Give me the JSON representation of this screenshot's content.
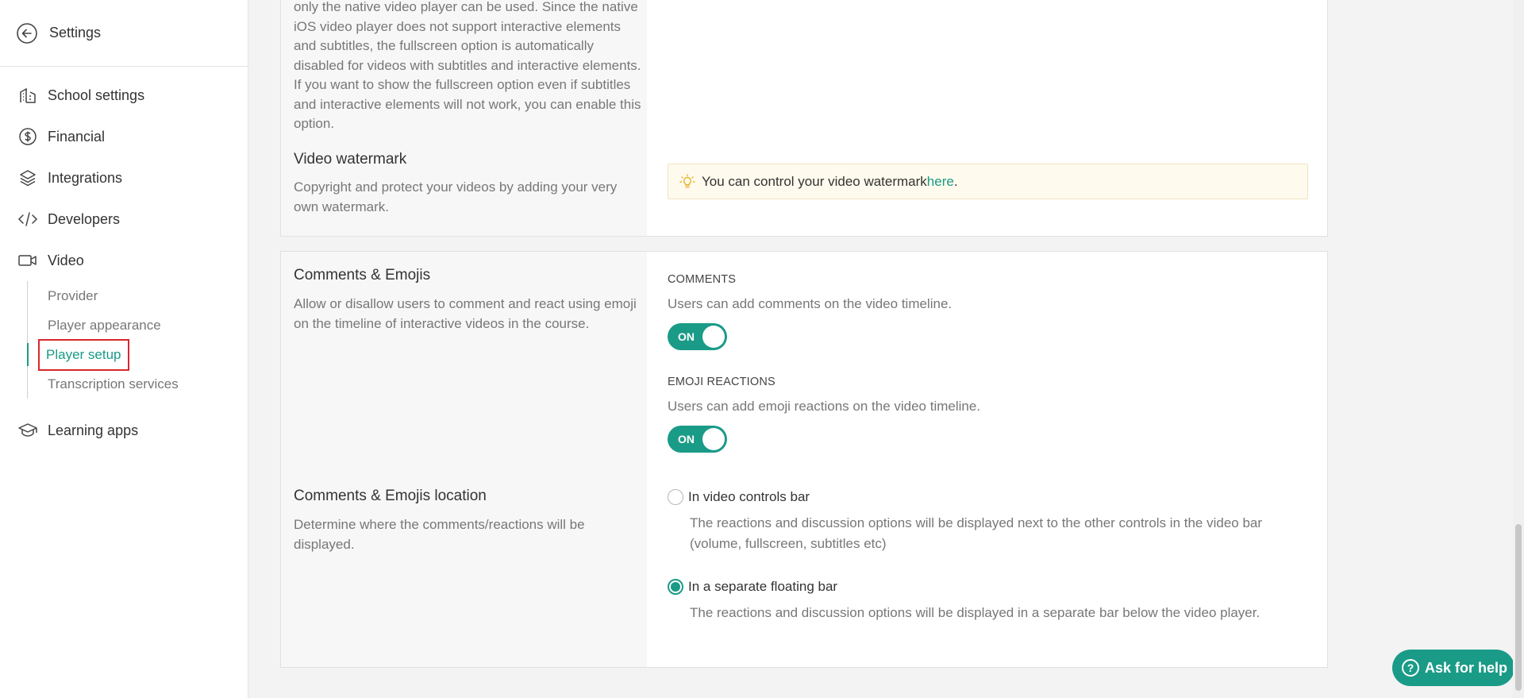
{
  "sidebar": {
    "title": "Settings",
    "items": [
      {
        "label": "School settings",
        "icon": "building-icon"
      },
      {
        "label": "Financial",
        "icon": "dollar-circle-icon"
      },
      {
        "label": "Integrations",
        "icon": "layers-icon"
      },
      {
        "label": "Developers",
        "icon": "code-icon"
      },
      {
        "label": "Video",
        "icon": "video-camera-icon"
      }
    ],
    "video_sub": [
      {
        "label": "Provider"
      },
      {
        "label": "Player appearance"
      },
      {
        "label": "Player setup",
        "active": true
      },
      {
        "label": "Transcription services"
      }
    ],
    "learning_apps": {
      "label": "Learning apps",
      "icon": "graduation-cap-icon"
    }
  },
  "fullscreen_section": {
    "desc_partial": "only the native video player can be used. Since the native iOS video player does not support interactive elements and subtitles, the fullscreen option is automatically disabled for videos with subtitles and interactive elements. If you want to show the fullscreen option even if subtitles and interactive elements will not work, you can enable this option."
  },
  "watermark": {
    "title": "Video watermark",
    "desc": "Copyright and protect your videos by adding your very own watermark.",
    "tip_text": "You can control your video watermark ",
    "tip_link": "here",
    "tip_end": "."
  },
  "comments": {
    "title": "Comments & Emojis",
    "desc": "Allow or disallow users to comment and react using emoji on the timeline of interactive videos in the course.",
    "comments_label": "COMMENTS",
    "comments_desc": "Users can add comments on the video timeline.",
    "comments_toggle": "ON",
    "emoji_label": "EMOJI REACTIONS",
    "emoji_desc": "Users can add emoji reactions on the video timeline.",
    "emoji_toggle": "ON"
  },
  "location": {
    "title": "Comments & Emojis location",
    "desc": "Determine where the comments/reactions will be displayed.",
    "options": [
      {
        "label": "In video controls bar",
        "desc": "The reactions and discussion options will be displayed next to the other controls in the video bar (volume, fullscreen, subtitles etc)",
        "checked": false
      },
      {
        "label": "In a separate floating bar",
        "desc": "The reactions and discussion options will be displayed in a separate bar below the video player.",
        "checked": true
      }
    ]
  },
  "help": {
    "label": "Ask for help"
  },
  "colors": {
    "accent": "#1a9b87",
    "highlight": "#d8282c",
    "tip_bg": "#fefaed"
  }
}
